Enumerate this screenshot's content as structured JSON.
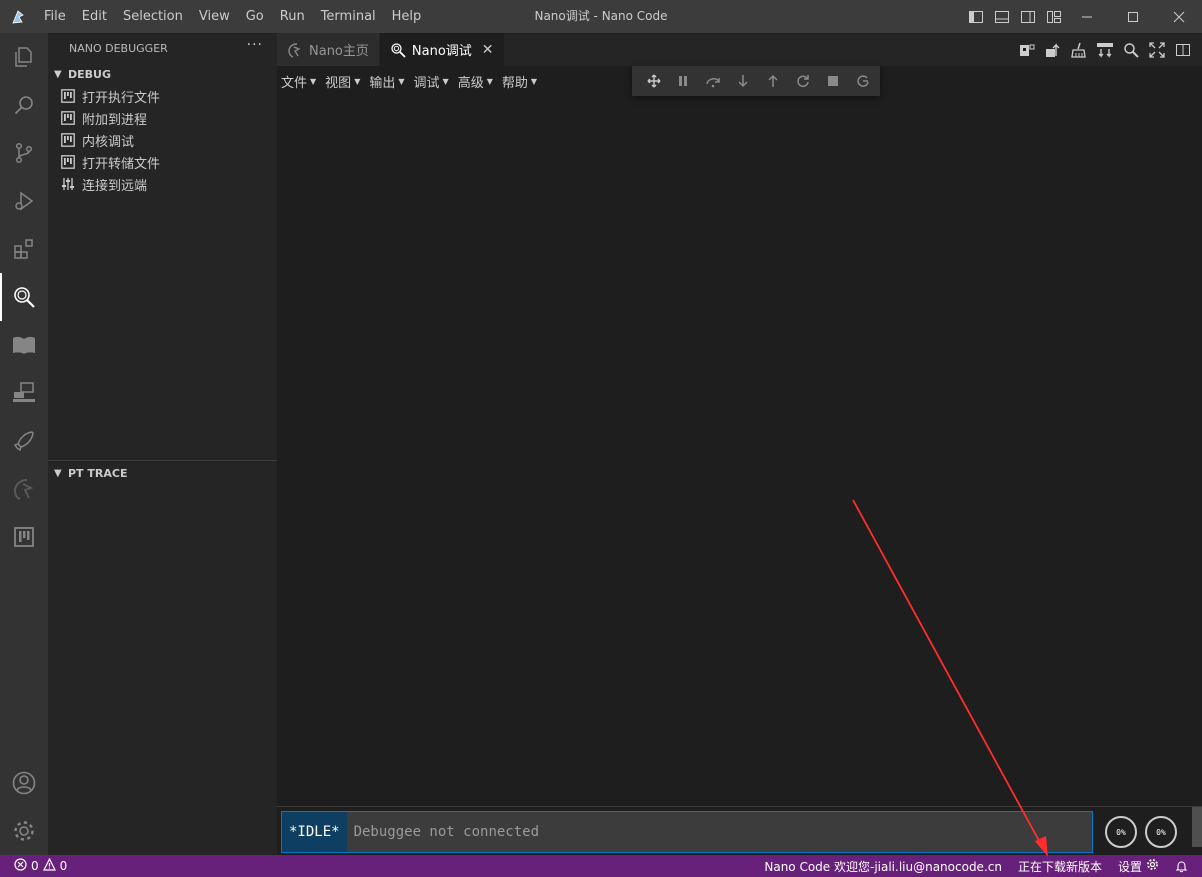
{
  "window": {
    "title": "Nano调试 - Nano Code",
    "menu": [
      "File",
      "Edit",
      "Selection",
      "View",
      "Go",
      "Run",
      "Terminal",
      "Help"
    ]
  },
  "activity_bar": {
    "items": [
      "explorer-icon",
      "search-icon",
      "source-control-icon",
      "run-debug-icon",
      "extensions-icon",
      "nano-debugger-icon",
      "book-icon",
      "remote-icon",
      "rocket-icon",
      "nano-logo-icon",
      "kanban-icon"
    ],
    "bottom": [
      "account-icon",
      "settings-gear-icon"
    ]
  },
  "sidebar": {
    "title": "NANO DEBUGGER",
    "more": "···",
    "debug_section": {
      "label": "DEBUG",
      "items": [
        {
          "label": "打开执行文件",
          "icon": "kanban-icon"
        },
        {
          "label": "附加到进程",
          "icon": "kanban-icon"
        },
        {
          "label": "内核调试",
          "icon": "kanban-icon"
        },
        {
          "label": "打开转储文件",
          "icon": "kanban-icon"
        },
        {
          "label": "连接到远端",
          "icon": "sliders-icon"
        }
      ]
    },
    "pt_section": {
      "label": "PT TRACE"
    }
  },
  "tabs": [
    {
      "label": "Nano主页",
      "icon": "nano-logo-icon",
      "active": false
    },
    {
      "label": "Nano调试",
      "icon": "nano-debugger-icon",
      "active": true,
      "close": "✕"
    }
  ],
  "editor": {
    "menu": [
      "文件",
      "视图",
      "输出",
      "调试",
      "高级",
      "帮助"
    ],
    "debug_toolbar": [
      "move-grip-icon",
      "pause-icon",
      "step-over-icon",
      "step-into-icon",
      "step-out-icon",
      "restart-icon",
      "stop-icon",
      "disconnect-icon"
    ],
    "console": {
      "state": "*IDLE*",
      "message": "Debuggee not connected"
    },
    "gauges": [
      "0%",
      "0%"
    ]
  },
  "statusbar": {
    "errors": "0",
    "warnings": "0",
    "welcome": "Nano Code 欢迎您-jiali.liu@nanocode.cn",
    "update": "正在下载新版本",
    "settings": "设置"
  },
  "colors": {
    "statusbar": "#68217a",
    "accent": "#007acc",
    "annotation_arrow": "#ff2d2d"
  }
}
